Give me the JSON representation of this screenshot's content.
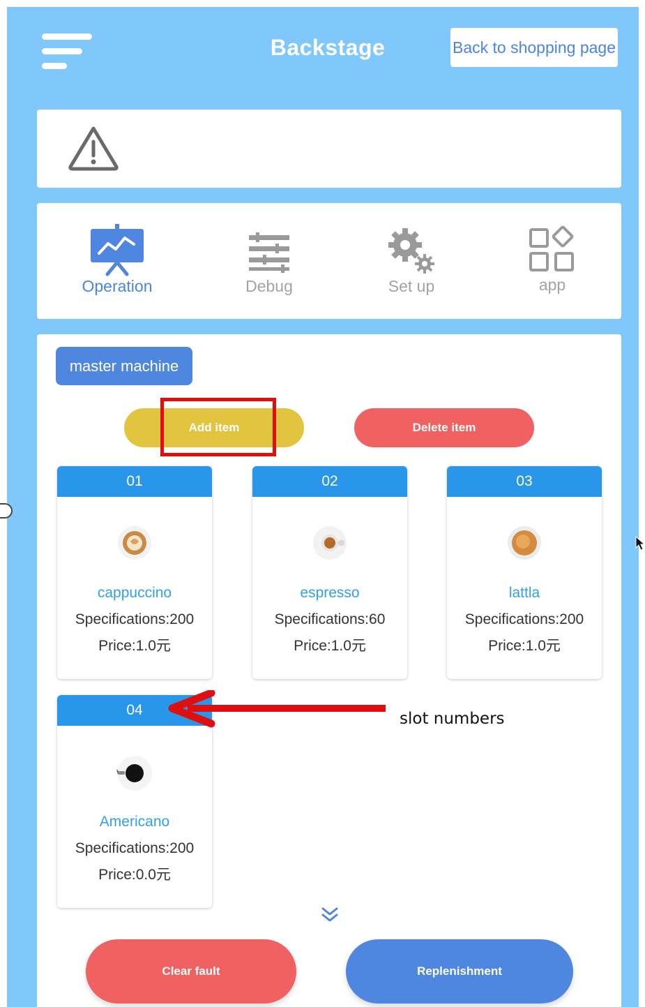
{
  "header": {
    "title": "Backstage",
    "back_button_label": "Back to shopping page"
  },
  "nav": {
    "items": [
      {
        "label": "Operation",
        "icon": "presentation-chart-icon",
        "active": true
      },
      {
        "label": "Debug",
        "icon": "sliders-icon",
        "active": false
      },
      {
        "label": "Set up",
        "icon": "gears-icon",
        "active": false
      },
      {
        "label": "app",
        "icon": "app-grid-icon",
        "active": false
      }
    ]
  },
  "machine_tab": "master machine",
  "actions": {
    "add_item": "Add item",
    "delete_item": "Delete item"
  },
  "slots": [
    {
      "number": "01",
      "name": "cappuccino",
      "spec": "Specifications:200",
      "price": "Price:1.0元",
      "icon": "cappuccino-cup-icon"
    },
    {
      "number": "02",
      "name": "espresso",
      "spec": "Specifications:60",
      "price": "Price:1.0元",
      "icon": "espresso-cup-icon"
    },
    {
      "number": "03",
      "name": "lattla",
      "spec": "Specifications:200",
      "price": "Price:1.0元",
      "icon": "latte-cup-icon"
    },
    {
      "number": "04",
      "name": "Americano",
      "spec": "Specifications:200",
      "price": "Price:0.0元",
      "icon": "americano-cup-icon"
    }
  ],
  "annotation": "slot numbers",
  "bottom": {
    "clear_fault": "Clear fault",
    "replenishment": "Replenishment"
  },
  "colors": {
    "background": "#80c7fb",
    "accent_blue": "#4f87e0",
    "slot_header": "#2a96ea",
    "add_yellow": "#e3c43f",
    "delete_red": "#f06161",
    "annotation_red": "#e00f0f"
  }
}
